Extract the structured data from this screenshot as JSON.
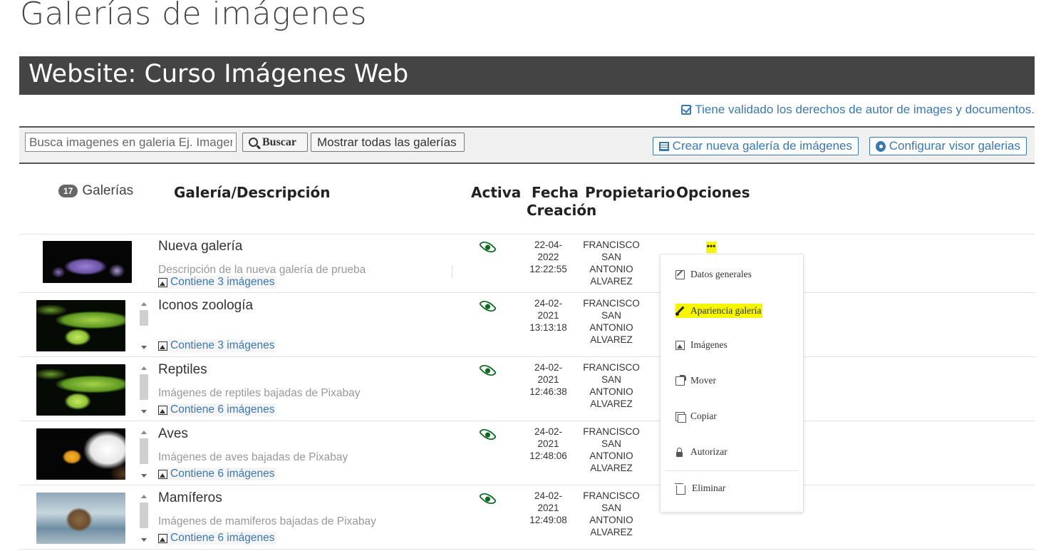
{
  "page": {
    "title": "Galerías de imágenes"
  },
  "site": {
    "title": "Website: Curso Imágenes Web"
  },
  "rights_note": "Tiene validado los derechos de autor de images y documentos.",
  "toolbar": {
    "search_placeholder": "Busca imagenes en galeria Ej. Imagen",
    "search_button": "Buscar",
    "show_all_button": "Mostrar todas las galerías",
    "create_button": "Crear nueva galería de imágenes",
    "config_button": "Configurar visor galerias"
  },
  "table": {
    "count": "17",
    "count_label": "Galerías",
    "headers": {
      "gallery": "Galería/Descripción",
      "active": "Activa",
      "date_line1": "Fecha",
      "date_line2": "Creación",
      "owner": "Propietario",
      "options": "Opciones"
    },
    "rows": [
      {
        "title": "Nueva galería",
        "description": "Descripción de la nueva galería de prueba",
        "count_text": "Contiene 3 imágenes",
        "date": "22-04-",
        "year": "2022",
        "time": "12:22:55",
        "owner1": "FRANCISCO",
        "owner2": "SAN",
        "owner3": "ANTONIO",
        "owner4": "ALVAREZ"
      },
      {
        "title": "Iconos zoología",
        "description": "",
        "count_text": "Contiene 3 imágenes",
        "date": "24-02-",
        "year": "2021",
        "time": "13:13:18",
        "owner1": "FRANCISCO",
        "owner2": "SAN",
        "owner3": "ANTONIO",
        "owner4": "ALVAREZ"
      },
      {
        "title": "Reptiles",
        "description": "Imágenes de reptiles bajadas de Pixabay",
        "count_text": "Contiene 6 imágenes",
        "date": "24-02-",
        "year": "2021",
        "time": "12:46:38",
        "owner1": "FRANCISCO",
        "owner2": "SAN",
        "owner3": "ANTONIO",
        "owner4": "ALVAREZ"
      },
      {
        "title": "Aves",
        "description": "Imágenes de aves bajadas de Pixabay",
        "count_text": "Contiene 6 imágenes",
        "date": "24-02-",
        "year": "2021",
        "time": "12:48:06",
        "owner1": "FRANCISCO",
        "owner2": "SAN",
        "owner3": "ANTONIO",
        "owner4": "ALVAREZ"
      },
      {
        "title": "Mamíferos",
        "description": "Imágenes de mamiferos bajadas de Pixabay",
        "count_text": "Contiene 6 imágenes",
        "date": "24-02-",
        "year": "2021",
        "time": "12:49:08",
        "owner1": "FRANCISCO",
        "owner2": "SAN",
        "owner3": "ANTONIO",
        "owner4": "ALVAREZ"
      }
    ]
  },
  "options_menu": {
    "trigger": "•••",
    "items": [
      "Datos generales",
      "Apariencia galería",
      "Imágenes",
      "Mover",
      "Copiar",
      "Autorizar",
      "Eliminar"
    ]
  },
  "colors": {
    "banner": "#444444",
    "link": "#3a78b0",
    "eye": "#0a6d1e",
    "highlight": "#f6f600"
  }
}
